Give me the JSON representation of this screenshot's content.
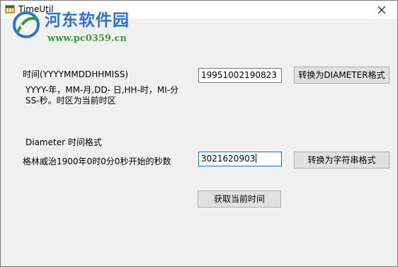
{
  "window": {
    "title": "TimeUtil",
    "close_glyph": "✕"
  },
  "watermark": {
    "title": "河东软件园",
    "url": "www.pc0359.cn"
  },
  "section1": {
    "label": "时间(YYYYMMDDHHMISS)",
    "desc_line1": "YYYY-年，MM-月,DD- 日,HH-时，MI-分",
    "desc_line2": "SS-秒。时区为当前时区",
    "input_value": "19951002190823",
    "button_label": "转换为DIAMETER格式"
  },
  "section2": {
    "label": "Diameter 时间格式",
    "desc": "格林威治1900年0时0分0秒开始的秒数",
    "input_value": "3021620903",
    "button_label": "转换为字符串格式"
  },
  "current_time_button": "获取当前时间",
  "icons": {
    "app": "app-icon",
    "close": "close-icon",
    "watermark_logo": "watermark-logo-icon"
  },
  "colors": {
    "watermark_blue": "#2e74c9",
    "watermark_green": "#3a9a3a",
    "focus_border": "#0078d7"
  }
}
